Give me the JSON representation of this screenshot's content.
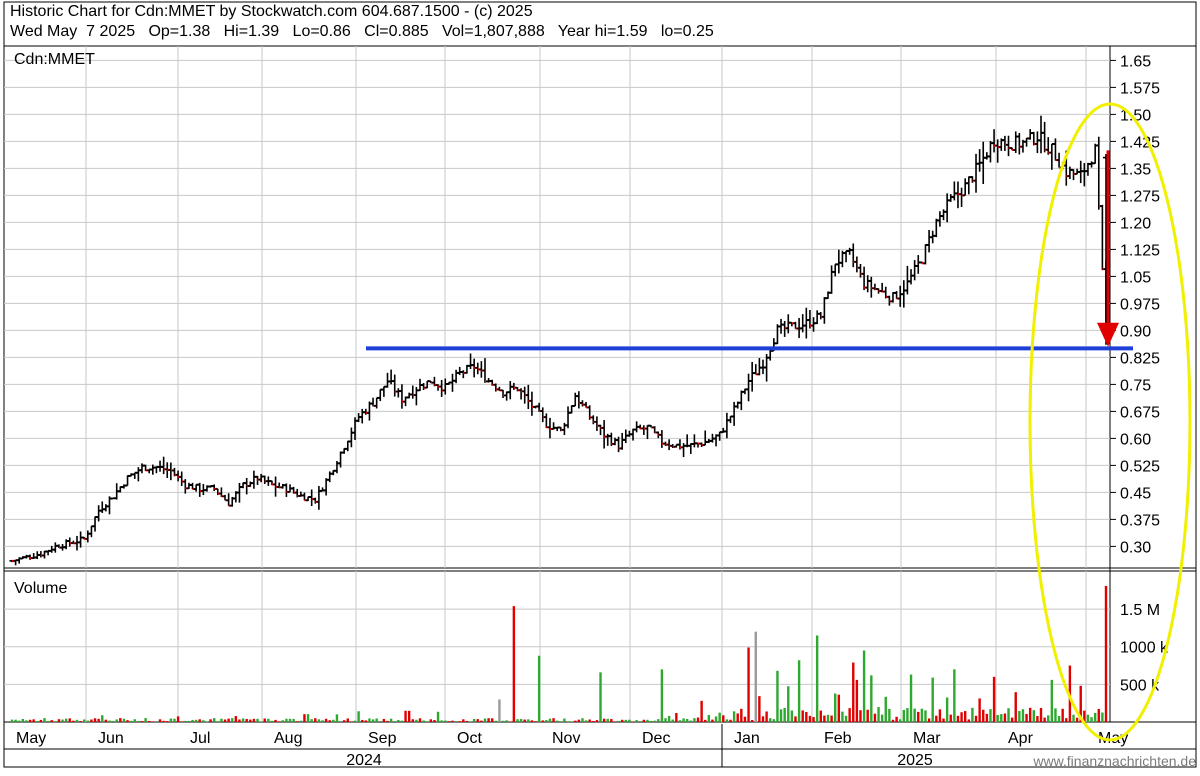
{
  "header": {
    "line1": "Historic Chart for Cdn:MMET by Stockwatch.com 604.687.1500 - (c) 2025",
    "line2": "Wed May  7 2025   Op=1.38   Hi=1.39   Lo=0.86   Cl=0.885   Vol=1,807,888   Year hi=1.59   lo=0.25"
  },
  "watermark": "www.finanznachrichten.de",
  "colors": {
    "up": "#000000",
    "down_mark": "#e00000",
    "vol_up": "#2ea82e",
    "vol_down": "#e00000",
    "vol_flat": "#9a9a9a",
    "grid": "#c8c8c8",
    "resistance": "#1f3fd8",
    "arrow": "#e00000",
    "highlight": "#f0f000"
  },
  "chart_data": {
    "type": "ohlc",
    "title": "Cdn:MMET",
    "volume_title": "Volume",
    "price_range": [
      0.24,
      1.69
    ],
    "price_ticks": [
      "1.65",
      "1.575",
      "1.50",
      "1.425",
      "1.35",
      "1.275",
      "1.20",
      "1.125",
      "1.05",
      "0.975",
      "0.90",
      "0.825",
      "0.75",
      "0.675",
      "0.60",
      "0.525",
      "0.45",
      "0.375",
      "0.30"
    ],
    "volume_range": [
      0,
      1900000
    ],
    "volume_ticks": [
      "1.5 M",
      "1000 k",
      "500 k"
    ],
    "months": [
      "May",
      "Jun",
      "Jul",
      "Aug",
      "Sep",
      "Oct",
      "Nov",
      "Dec",
      "Jan",
      "Feb",
      "Mar",
      "Apr",
      "May"
    ],
    "years": [
      "2024",
      "2025"
    ],
    "resistance_level": 0.85,
    "arrow": {
      "from": 1.4,
      "to": 0.86
    },
    "price_anchors": [
      [
        0,
        0.26
      ],
      [
        4,
        0.27
      ],
      [
        8,
        0.28
      ],
      [
        12,
        0.3
      ],
      [
        16,
        0.31
      ],
      [
        20,
        0.32
      ],
      [
        24,
        0.4
      ],
      [
        28,
        0.44
      ],
      [
        32,
        0.49
      ],
      [
        36,
        0.52
      ],
      [
        40,
        0.52
      ],
      [
        44,
        0.51
      ],
      [
        48,
        0.47
      ],
      [
        52,
        0.46
      ],
      [
        56,
        0.46
      ],
      [
        60,
        0.42
      ],
      [
        64,
        0.47
      ],
      [
        68,
        0.49
      ],
      [
        72,
        0.47
      ],
      [
        76,
        0.46
      ],
      [
        80,
        0.44
      ],
      [
        84,
        0.43
      ],
      [
        88,
        0.5
      ],
      [
        92,
        0.58
      ],
      [
        96,
        0.66
      ],
      [
        100,
        0.7
      ],
      [
        104,
        0.76
      ],
      [
        108,
        0.71
      ],
      [
        112,
        0.74
      ],
      [
        116,
        0.76
      ],
      [
        120,
        0.74
      ],
      [
        124,
        0.78
      ],
      [
        128,
        0.8
      ],
      [
        132,
        0.76
      ],
      [
        136,
        0.73
      ],
      [
        140,
        0.74
      ],
      [
        144,
        0.69
      ],
      [
        148,
        0.64
      ],
      [
        152,
        0.62
      ],
      [
        156,
        0.72
      ],
      [
        160,
        0.66
      ],
      [
        164,
        0.61
      ],
      [
        168,
        0.58
      ],
      [
        172,
        0.62
      ],
      [
        176,
        0.63
      ],
      [
        180,
        0.59
      ],
      [
        184,
        0.58
      ],
      [
        188,
        0.58
      ],
      [
        192,
        0.59
      ],
      [
        196,
        0.61
      ],
      [
        200,
        0.68
      ],
      [
        204,
        0.76
      ],
      [
        208,
        0.81
      ],
      [
        212,
        0.9
      ],
      [
        216,
        0.91
      ],
      [
        220,
        0.92
      ],
      [
        224,
        0.94
      ],
      [
        228,
        1.09
      ],
      [
        232,
        1.11
      ],
      [
        236,
        1.03
      ],
      [
        240,
        1.01
      ],
      [
        244,
        0.99
      ],
      [
        248,
        1.03
      ],
      [
        252,
        1.1
      ],
      [
        256,
        1.2
      ],
      [
        260,
        1.26
      ],
      [
        264,
        1.3
      ],
      [
        268,
        1.36
      ],
      [
        272,
        1.43
      ],
      [
        276,
        1.42
      ],
      [
        280,
        1.42
      ],
      [
        284,
        1.44
      ],
      [
        288,
        1.4
      ],
      [
        292,
        1.34
      ],
      [
        296,
        1.33
      ],
      [
        300,
        1.4
      ],
      [
        303,
        0.885
      ]
    ],
    "volume_spikes": [
      [
        139,
        1540000,
        "down"
      ],
      [
        206,
        1200000,
        "flat"
      ],
      [
        204,
        990000,
        "down"
      ],
      [
        223,
        1150000,
        "up"
      ],
      [
        146,
        880000,
        "up"
      ],
      [
        236,
        950000,
        "up"
      ],
      [
        218,
        820000,
        "up"
      ],
      [
        233,
        790000,
        "down"
      ],
      [
        261,
        700000,
        "up"
      ],
      [
        293,
        750000,
        "down"
      ],
      [
        303,
        1807888,
        "down"
      ],
      [
        288,
        560000,
        "up"
      ],
      [
        255,
        590000,
        "up"
      ],
      [
        163,
        660000,
        "up"
      ],
      [
        180,
        700000,
        "up"
      ],
      [
        135,
        300000,
        "flat"
      ],
      [
        238,
        620000,
        "up"
      ],
      [
        272,
        600000,
        "down"
      ],
      [
        249,
        630000,
        "up"
      ],
      [
        212,
        680000,
        "up"
      ]
    ]
  }
}
